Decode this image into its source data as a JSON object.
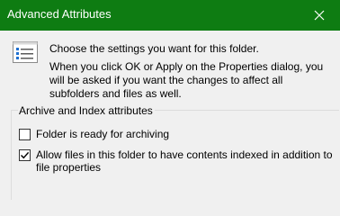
{
  "window": {
    "title": "Advanced Attributes",
    "titlebar_color": "#0e7c12",
    "close_icon": "close-icon"
  },
  "info": {
    "icon": "properties-list-icon",
    "line1": "Choose the settings you want for this folder.",
    "line2": "When you click OK or Apply on the Properties dialog, you will be asked if you want the changes to affect all subfolders and files as well."
  },
  "archive_index_group": {
    "label": "Archive and Index attributes",
    "archive_checkbox": {
      "label": "Folder is ready for archiving",
      "checked": false
    },
    "index_checkbox": {
      "label": "Allow files in this folder to have contents indexed in addition to file properties",
      "checked": true
    }
  }
}
